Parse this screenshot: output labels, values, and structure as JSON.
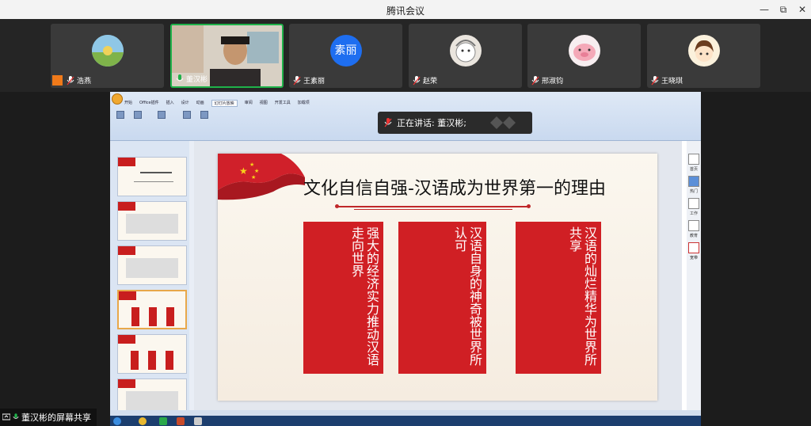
{
  "window": {
    "title": "腾讯会议",
    "min": "—",
    "max": "⧉",
    "close": "✕"
  },
  "participants": [
    {
      "name": "浩燕",
      "avatar_color": "#7fb8d6",
      "host": true
    },
    {
      "name": "董汉彬",
      "avatar_color": "#6b5a48",
      "active": true
    },
    {
      "name": "王素丽",
      "avatar_text": "素丽",
      "avatar_color": "#1e6ef0"
    },
    {
      "name": "赵荣",
      "avatar_color": "#e9e4de"
    },
    {
      "name": "邢淑钧",
      "avatar_color": "#f2b6c0"
    },
    {
      "name": "王晓琪",
      "avatar_color": "#f3e0b5"
    }
  ],
  "speaker": {
    "text": "正在讲话: 董汉彬;"
  },
  "share_label": "董汉彬的屏幕共享",
  "ppt": {
    "file_title": "",
    "tabs": [
      "开始",
      "Office插件",
      "插入",
      "设计",
      "动画",
      "幻灯片放映",
      "审阅",
      "视图",
      "开发工具",
      "加载项"
    ],
    "active_tab": "幻灯片放映",
    "right_bar": [
      "首页",
      "热门",
      "工作",
      "教育",
      "宽带"
    ],
    "slide": {
      "title": "文化自信自强-汉语成为世界第一的理由",
      "boxes": [
        "强大的经济实力推动汉语走向世界",
        "汉语自身的神奇被世界所认可",
        "汉语的灿烂精华为世界所共享"
      ]
    }
  },
  "colors": {
    "accent_red": "#d01f24",
    "speaking_green": "#1fb24a"
  }
}
